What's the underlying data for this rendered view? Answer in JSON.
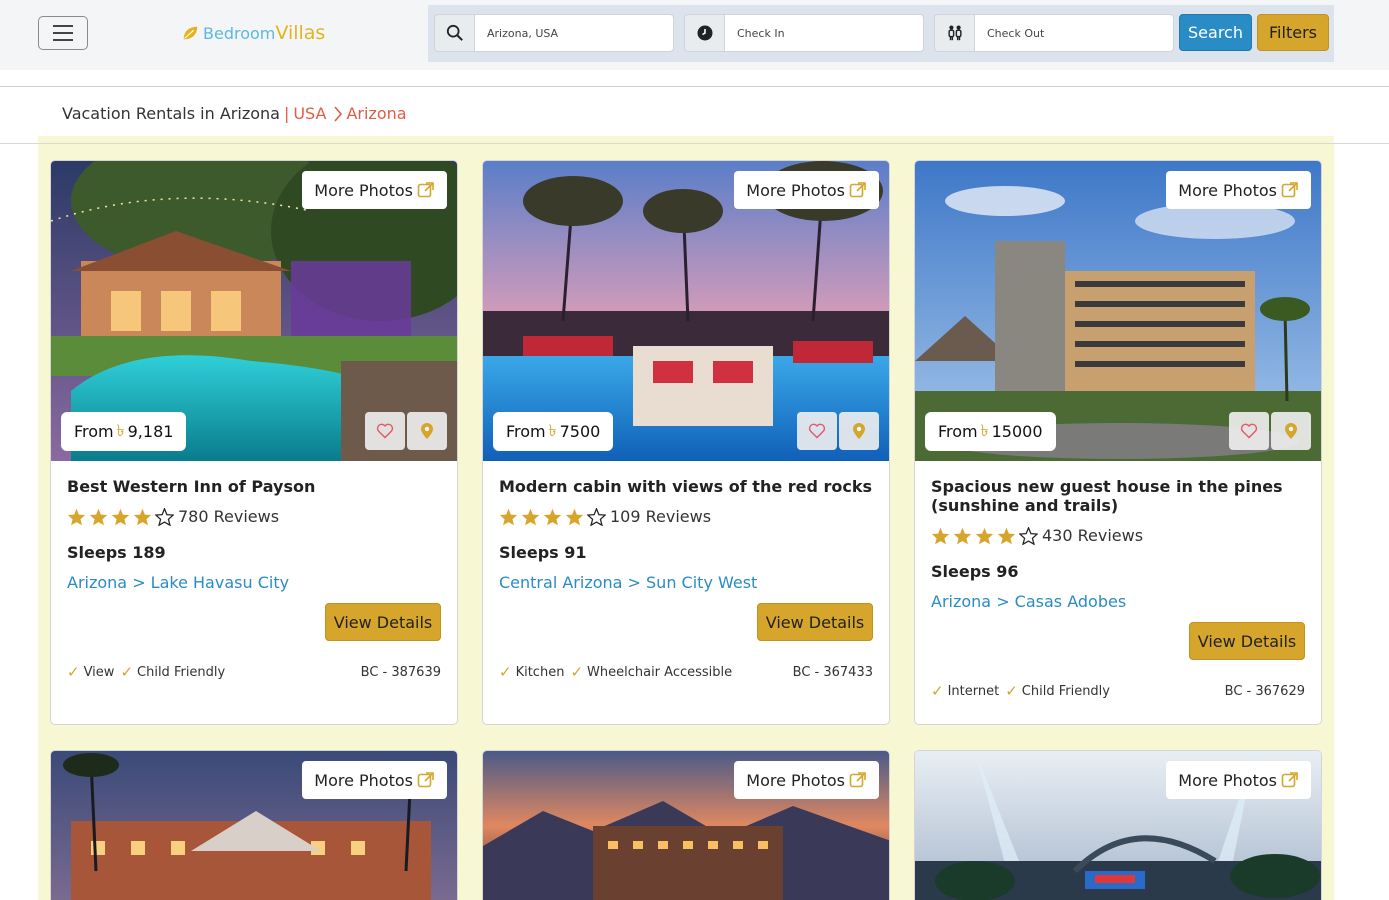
{
  "header": {
    "brand_part1": "Bedroom",
    "brand_part2": "Villas",
    "location_value": "Arizona, USA",
    "checkin_placeholder": "Check In",
    "checkout_placeholder": "Check Out",
    "search_label": "Search",
    "filters_label": "Filters"
  },
  "breadcrumb": {
    "title": "Vacation Rentals in Arizona",
    "sep": "|",
    "country": "USA",
    "state": "Arizona"
  },
  "cards": [
    {
      "more_photos": "More Photos",
      "price_prefix": "From",
      "currency": "৳",
      "price": "9,181",
      "title": "Best Western Inn of Payson",
      "rating": 4,
      "reviews": "780 Reviews",
      "sleeps": "Sleeps 189",
      "location": "Arizona > Lake Havasu City",
      "details_label": "View Details",
      "amenity1": "View",
      "amenity2": "Child Friendly",
      "code": "BC - 387639"
    },
    {
      "more_photos": "More Photos",
      "price_prefix": "From",
      "currency": "৳",
      "price": "7500",
      "title": "Modern cabin with views of the red rocks",
      "rating": 4,
      "reviews": "109 Reviews",
      "sleeps": "Sleeps 91",
      "location": "Central Arizona > Sun City West",
      "details_label": "View Details",
      "amenity1": "Kitchen",
      "amenity2": "Wheelchair Accessible",
      "code": "BC - 367433"
    },
    {
      "more_photos": "More Photos",
      "price_prefix": "From",
      "currency": "৳",
      "price": "15000",
      "title": "Spacious new guest house in the pines (sunshine and trails)",
      "rating": 4,
      "reviews": "430 Reviews",
      "sleeps": "Sleeps 96",
      "location": "Arizona > Casas Adobes",
      "details_label": "View Details",
      "amenity1": "Internet",
      "amenity2": "Child Friendly",
      "code": "BC - 367629"
    },
    {
      "more_photos": "More Photos"
    },
    {
      "more_photos": "More Photos"
    },
    {
      "more_photos": "More Photos"
    }
  ],
  "colors": {
    "accent_gold": "#d6a52c",
    "link_blue": "#2a8cc4",
    "breadcrumb_red": "#e05d44",
    "listing_bg": "#f8f7d4"
  }
}
